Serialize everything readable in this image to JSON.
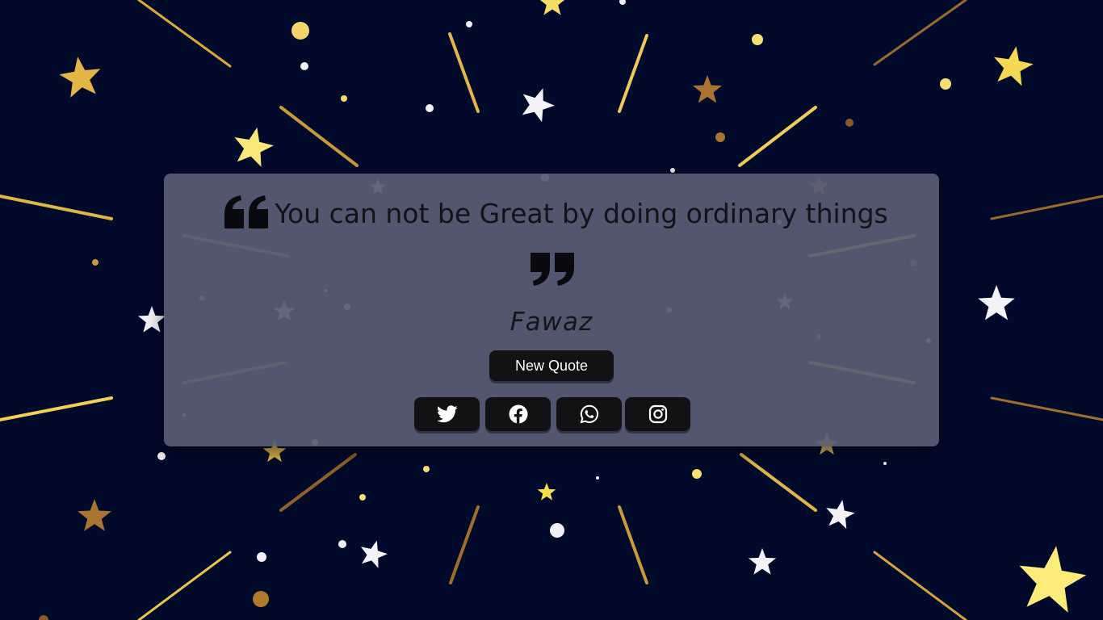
{
  "quote": {
    "text": "You can not be Great by doing ordinary things",
    "author": "Fawaz"
  },
  "buttons": {
    "new_quote_label": "New Quote"
  },
  "social": [
    "twitter-icon",
    "facebook-icon",
    "whatsapp-icon",
    "instagram-icon"
  ],
  "colors": {
    "background": "#020a2b",
    "card": "#585c73",
    "button": "#121114",
    "gold": "#e8b93c",
    "pale_yellow": "#fbe87a",
    "white_star": "#f2f2f7"
  }
}
